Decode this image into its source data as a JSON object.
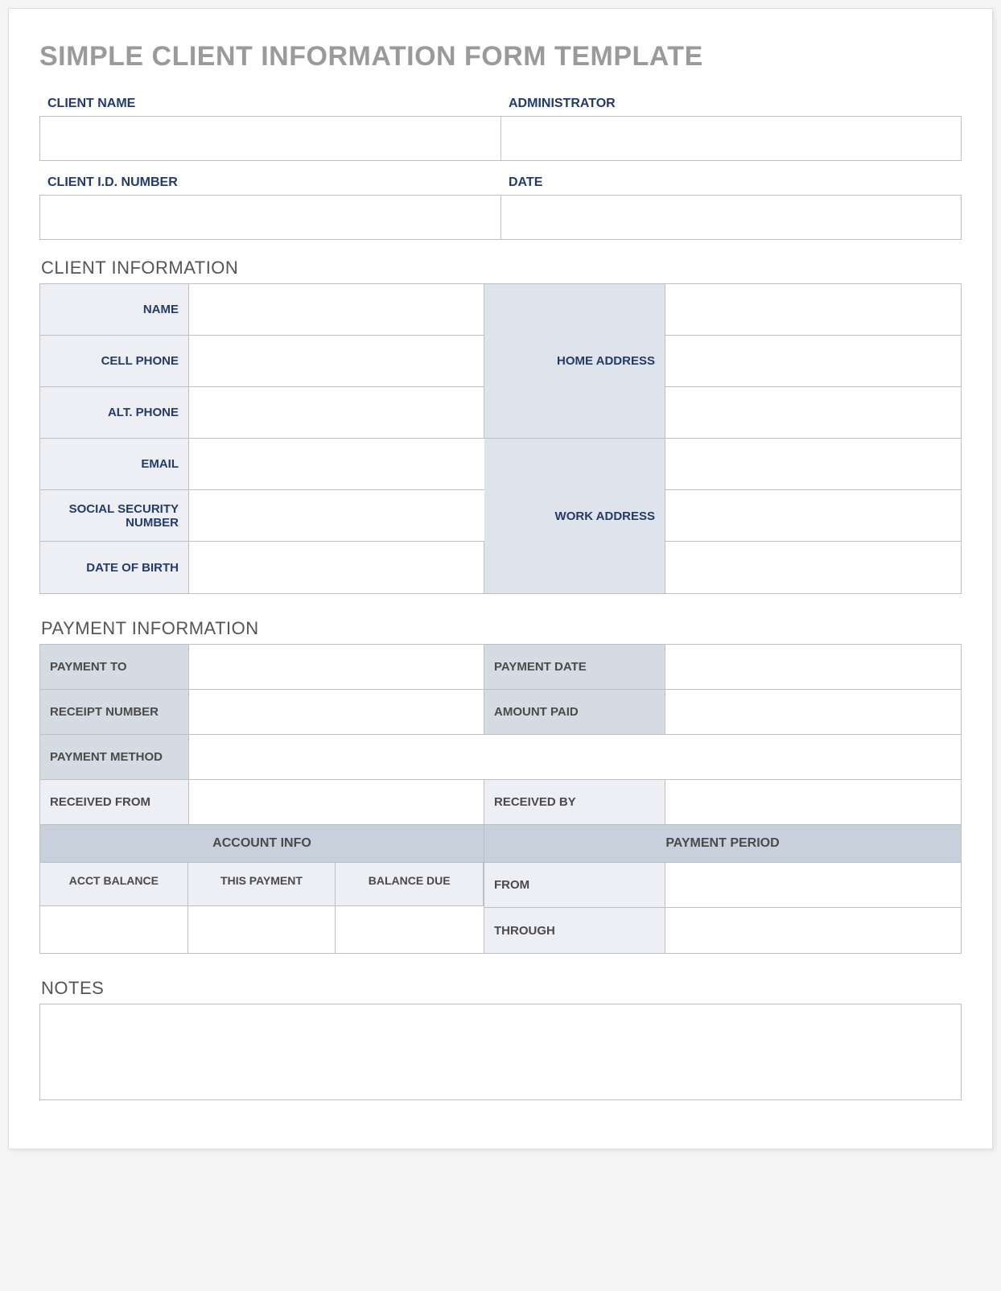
{
  "title": "SIMPLE CLIENT INFORMATION FORM TEMPLATE",
  "header": {
    "client_name_label": "CLIENT NAME",
    "administrator_label": "ADMINISTRATOR",
    "client_id_label": "CLIENT I.D. NUMBER",
    "date_label": "DATE",
    "client_name": "",
    "administrator": "",
    "client_id": "",
    "date": ""
  },
  "client_info": {
    "heading": "CLIENT INFORMATION",
    "name_label": "NAME",
    "cell_phone_label": "CELL PHONE",
    "alt_phone_label": "ALT. PHONE",
    "email_label": "EMAIL",
    "ssn_label": "SOCIAL SECURITY NUMBER",
    "dob_label": "DATE OF BIRTH",
    "home_address_label": "HOME ADDRESS",
    "work_address_label": "WORK ADDRESS",
    "name": "",
    "cell_phone": "",
    "alt_phone": "",
    "email": "",
    "ssn": "",
    "dob": "",
    "home_address_1": "",
    "home_address_2": "",
    "home_address_3": "",
    "work_address_1": "",
    "work_address_2": "",
    "work_address_3": ""
  },
  "payment_info": {
    "heading": "PAYMENT INFORMATION",
    "payment_to_label": "PAYMENT TO",
    "payment_date_label": "PAYMENT DATE",
    "receipt_number_label": "RECEIPT NUMBER",
    "amount_paid_label": "AMOUNT PAID",
    "payment_method_label": "PAYMENT METHOD",
    "received_from_label": "RECEIVED FROM",
    "received_by_label": "RECEIVED BY",
    "account_info_label": "ACCOUNT INFO",
    "payment_period_label": "PAYMENT PERIOD",
    "acct_balance_label": "ACCT BALANCE",
    "this_payment_label": "THIS PAYMENT",
    "balance_due_label": "BALANCE DUE",
    "from_label": "FROM",
    "through_label": "THROUGH",
    "payment_to": "",
    "payment_date": "",
    "receipt_number": "",
    "amount_paid": "",
    "payment_method": "",
    "received_from": "",
    "received_by": "",
    "acct_balance": "",
    "this_payment": "",
    "balance_due": "",
    "from": "",
    "through": ""
  },
  "notes": {
    "heading": "NOTES",
    "value": ""
  }
}
